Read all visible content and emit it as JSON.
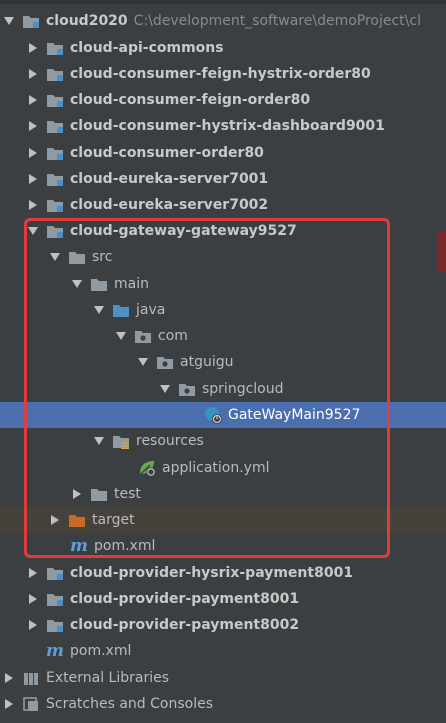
{
  "colors": {
    "background": "#3c3f41",
    "selection": "#4b6eaf",
    "highlight_box": "#e23b3b",
    "folder": "#8f9aa3",
    "source_folder": "#4d8fc7",
    "excluded_folder": "#c9682d"
  },
  "tree": {
    "root": {
      "name": "cloud2020",
      "path": "C:\\development_software\\demoProject\\cl"
    },
    "modules_top": [
      "cloud-api-commons",
      "cloud-consumer-feign-hystrix-order80",
      "cloud-consumer-feign-order80",
      "cloud-consumer-hystrix-dashboard9001",
      "cloud-consumer-order80",
      "cloud-eureka-server7001",
      "cloud-eureka-server7002"
    ],
    "gateway": {
      "name": "cloud-gateway-gateway9527",
      "src": "src",
      "main": "main",
      "java": "java",
      "com": "com",
      "atguigu": "atguigu",
      "springcloud": "springcloud",
      "main_class": "GateWayMain9527",
      "resources": "resources",
      "app_yml": "application.yml",
      "test": "test",
      "target": "target",
      "pom": "pom.xml"
    },
    "modules_bottom": [
      "cloud-provider-hysrix-payment8001",
      "cloud-provider-payment8001",
      "cloud-provider-payment8002"
    ],
    "root_pom": "pom.xml",
    "external_libraries": "External Libraries",
    "scratches": "Scratches and Consoles"
  },
  "icons": {
    "arrow_expanded": "triangle-down-icon",
    "arrow_collapsed": "triangle-right-icon",
    "module": "module-folder-icon",
    "folder": "folder-icon",
    "source_root": "source-root-icon",
    "package": "package-icon",
    "resources": "resources-root-icon",
    "spring_boot_class": "spring-boot-class-icon",
    "spring_yml": "spring-leaf-icon",
    "maven": "maven-m-icon",
    "library": "library-icon",
    "scratches": "scratches-icon"
  }
}
